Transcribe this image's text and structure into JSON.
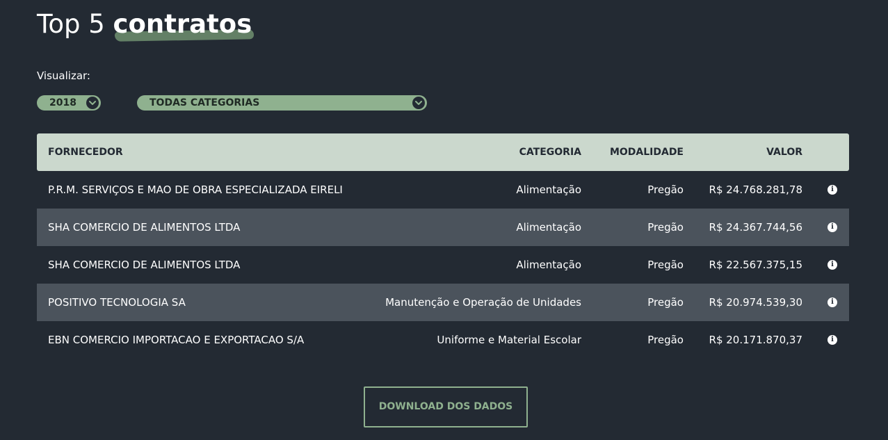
{
  "title": {
    "prefix": "Top 5",
    "highlight": "contratos"
  },
  "filters": {
    "label": "Visualizar:",
    "year": "2018",
    "category": "TODAS CATEGORIAS"
  },
  "table": {
    "headers": {
      "fornecedor": "FORNECEDOR",
      "categoria": "CATEGORIA",
      "modalidade": "MODALIDADE",
      "valor": "VALOR"
    },
    "rows": [
      {
        "fornecedor": "P.R.M. SERVIÇOS E MAO DE OBRA ESPECIALIZADA EIRELI",
        "categoria": "Alimentação",
        "modalidade": "Pregão",
        "valor": "R$ 24.768.281,78"
      },
      {
        "fornecedor": "SHA COMERCIO DE ALIMENTOS LTDA",
        "categoria": "Alimentação",
        "modalidade": "Pregão",
        "valor": "R$ 24.367.744,56"
      },
      {
        "fornecedor": "SHA COMERCIO DE ALIMENTOS LTDA",
        "categoria": "Alimentação",
        "modalidade": "Pregão",
        "valor": "R$ 22.567.375,15"
      },
      {
        "fornecedor": "POSITIVO TECNOLOGIA SA",
        "categoria": "Manutenção e Operação de Unidades",
        "modalidade": "Pregão",
        "valor": "R$ 20.974.539,30"
      },
      {
        "fornecedor": "EBN COMERCIO IMPORTACAO E EXPORTACAO S/A",
        "categoria": "Uniforme e Material Escolar",
        "modalidade": "Pregão",
        "valor": "R$ 20.171.870,37"
      }
    ],
    "info_icon": "info-icon"
  },
  "download": {
    "label": "DOWNLOAD DOS DADOS"
  },
  "colors": {
    "background": "#232a33",
    "accent": "#8fb18f",
    "header_bg": "#cbd8cd",
    "alt_row": "#4b535c"
  }
}
